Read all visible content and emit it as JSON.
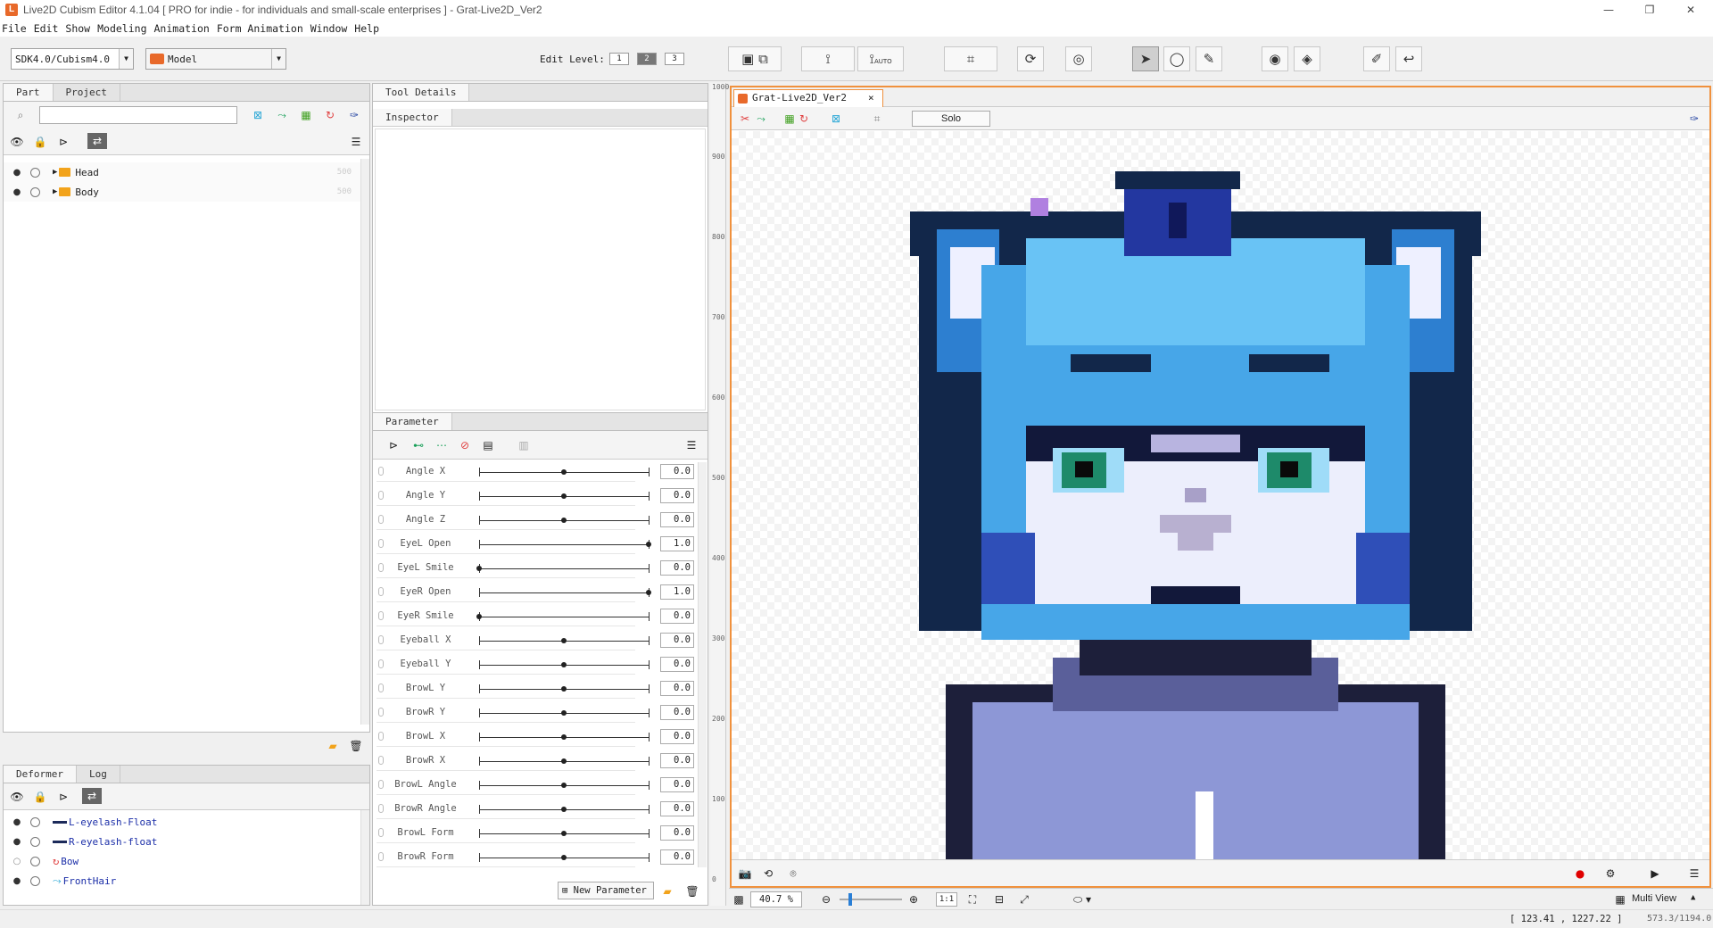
{
  "window": {
    "title": "Live2D Cubism Editor 4.1.04   [ PRO for indie - for individuals and small-scale enterprises ]  - Grat-Live2D_Ver2",
    "controls": [
      "—",
      "❐",
      "✕"
    ]
  },
  "menu": [
    "File",
    "Edit",
    "Show",
    "Modeling",
    "Animation",
    "Form Animation",
    "Window",
    "Help"
  ],
  "toolbar": {
    "sdk_value": "SDK4.0/Cubism4.0",
    "mode_value": "Model",
    "edit_level_label": "Edit Level:",
    "levels": [
      "1",
      "2",
      "3"
    ],
    "auto_label": "AUTO"
  },
  "left_panel": {
    "tabs": [
      "Part",
      "Project"
    ],
    "parts": [
      {
        "name": "Head",
        "count": "500"
      },
      {
        "name": "Body",
        "count": "500"
      }
    ]
  },
  "tool_details": {
    "tab": "Tool Details",
    "inspector_tab": "Inspector"
  },
  "parameter_panel": {
    "tab": "Parameter",
    "new_parameter_label": "New Parameter",
    "params": [
      {
        "name": "Angle X",
        "value": "0.0",
        "pos": 0.5
      },
      {
        "name": "Angle Y",
        "value": "0.0",
        "pos": 0.5
      },
      {
        "name": "Angle Z",
        "value": "0.0",
        "pos": 0.5
      },
      {
        "name": "EyeL Open",
        "value": "1.0",
        "pos": 1.0
      },
      {
        "name": "EyeL Smile",
        "value": "0.0",
        "pos": 0.0
      },
      {
        "name": "EyeR Open",
        "value": "1.0",
        "pos": 1.0
      },
      {
        "name": "EyeR Smile",
        "value": "0.0",
        "pos": 0.0
      },
      {
        "name": "Eyeball X",
        "value": "0.0",
        "pos": 0.5
      },
      {
        "name": "Eyeball Y",
        "value": "0.0",
        "pos": 0.5
      },
      {
        "name": "BrowL Y",
        "value": "0.0",
        "pos": 0.5
      },
      {
        "name": "BrowR Y",
        "value": "0.0",
        "pos": 0.5
      },
      {
        "name": "BrowL X",
        "value": "0.0",
        "pos": 0.5
      },
      {
        "name": "BrowR X",
        "value": "0.0",
        "pos": 0.5
      },
      {
        "name": "BrowL Angle",
        "value": "0.0",
        "pos": 0.5
      },
      {
        "name": "BrowR Angle",
        "value": "0.0",
        "pos": 0.5
      },
      {
        "name": "BrowL Form",
        "value": "0.0",
        "pos": 0.5
      },
      {
        "name": "BrowR Form",
        "value": "0.0",
        "pos": 0.5
      }
    ]
  },
  "deformer_panel": {
    "tabs": [
      "Deformer",
      "Log"
    ],
    "items": [
      {
        "name": "L-eyelash-Float"
      },
      {
        "name": "R-eyelash-float"
      },
      {
        "name": "Bow"
      },
      {
        "name": "FrontHair"
      }
    ]
  },
  "canvas": {
    "tab": "Grat-Live2D_Ver2",
    "solo_label": "Solo",
    "ruler": [
      "1000",
      "900",
      "800",
      "700",
      "600",
      "500",
      "400",
      "300",
      "200",
      "100",
      "0"
    ],
    "zoom": "40.7 %",
    "ratio_label": "1:1",
    "multi_view_label": "Multi View"
  },
  "statusbar": {
    "coords": "[  123.41 ,  1227.22 ]",
    "size": "573.3/1194.0"
  },
  "colors": {
    "accent": "#e8692a",
    "canvas_border": "#f0913d",
    "record": "#e00000",
    "deformer_text": "#1c2fa8"
  }
}
